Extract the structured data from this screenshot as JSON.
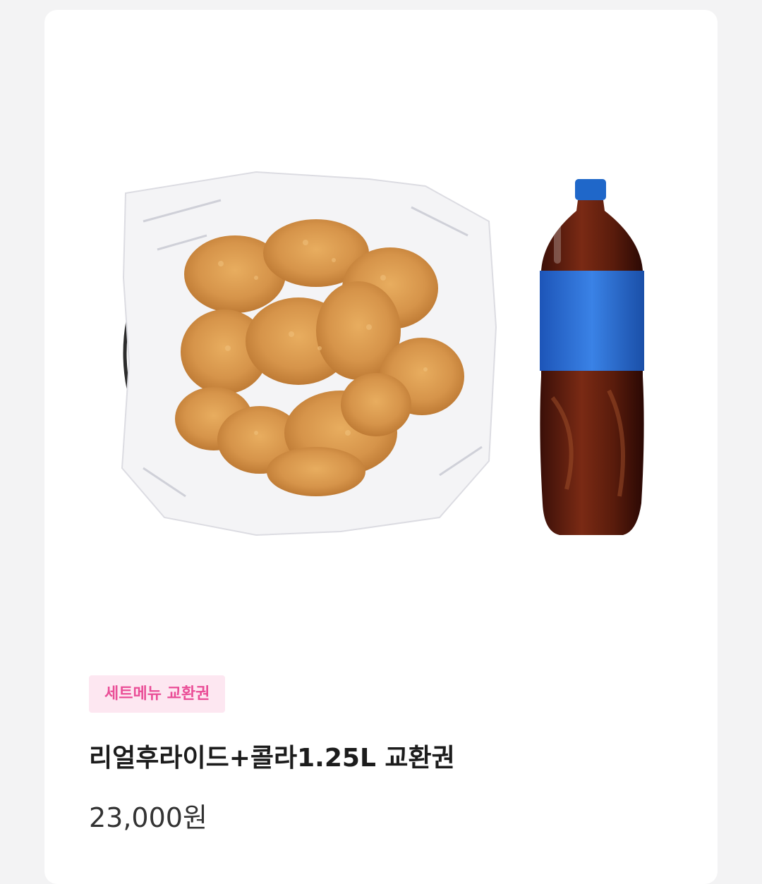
{
  "product": {
    "image_alt": "fried-chicken-and-cola-image",
    "badge": "세트메뉴 교환권",
    "title": "리얼후라이드+콜라1.25L 교환권",
    "price": "23,000원"
  },
  "colors": {
    "background": "#f3f3f4",
    "card": "#ffffff",
    "badge_bg": "#fde7f1",
    "badge_text": "#ea4e97",
    "title_text": "#1c1c1c",
    "price_text": "#333333",
    "chicken": "#d99a4e",
    "cola_cap": "#1f67c9",
    "cola_label": "#2a6fd4"
  }
}
